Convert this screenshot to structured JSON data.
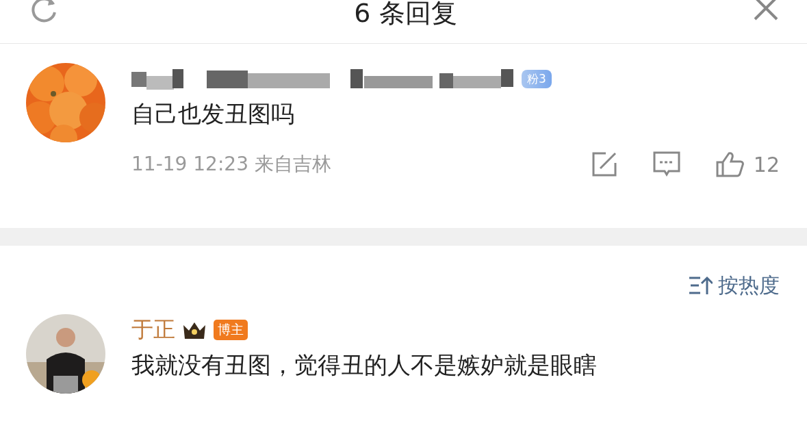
{
  "header": {
    "title": "6 条回复"
  },
  "root_comment": {
    "fan_badge": "粉3",
    "text": "自己也发丑图吗",
    "meta": "11-19 12:23 来自吉林",
    "likes": "12"
  },
  "sort": {
    "label": "按热度"
  },
  "replies": [
    {
      "name": "于正",
      "role_badge": "博主",
      "text": "我就没有丑图，觉得丑的人不是嫉妒就是眼瞎"
    }
  ]
}
